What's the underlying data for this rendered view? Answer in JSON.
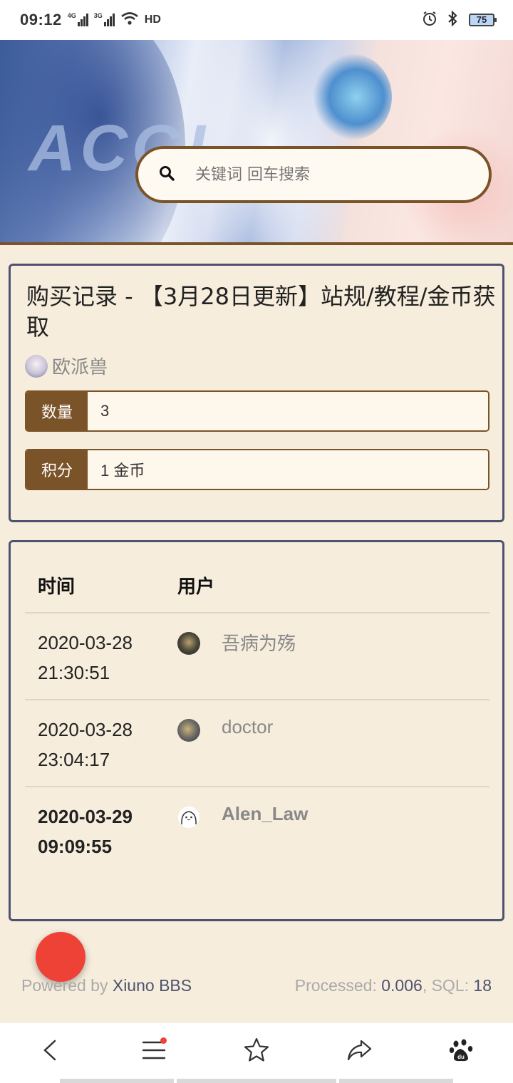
{
  "status_bar": {
    "time": "09:12",
    "net1": "4G",
    "net2": "3G",
    "hd": "HD",
    "battery": "75"
  },
  "banner": {
    "logo_text": "ACGI"
  },
  "search": {
    "placeholder": "关键词 回车搜索"
  },
  "thread": {
    "title": "购买记录 - 【3月28日更新】站规/教程/金币获取",
    "author": "欧派兽",
    "fields": [
      {
        "label": "数量",
        "value": "3"
      },
      {
        "label": "积分",
        "value": "1 金币"
      }
    ]
  },
  "records": {
    "headers": {
      "time": "时间",
      "user": "用户"
    },
    "rows": [
      {
        "date": "2020-03-28",
        "clock": "21:30:51",
        "user": "吾病为殇"
      },
      {
        "date": "2020-03-28",
        "clock": "23:04:17",
        "user": "doctor"
      },
      {
        "date": "2020-03-29",
        "clock": "09:09:55",
        "user": "Alen_Law"
      }
    ]
  },
  "footer": {
    "powered_prefix": "Powered by",
    "powered_link": "Xiuno BBS",
    "processed_label": "Processed:",
    "processed_value": "0.006",
    "sql_label": ", SQL:",
    "sql_value": "18"
  },
  "bottom_nav": {
    "icons": [
      "back-icon",
      "menu-icon",
      "star-icon",
      "share-icon",
      "baidu-paw-icon"
    ]
  },
  "colors": {
    "accent_brown": "#7a5329",
    "card_border": "#4e5270",
    "page_bg": "#f6eddc",
    "fab_red": "#ef4236"
  }
}
